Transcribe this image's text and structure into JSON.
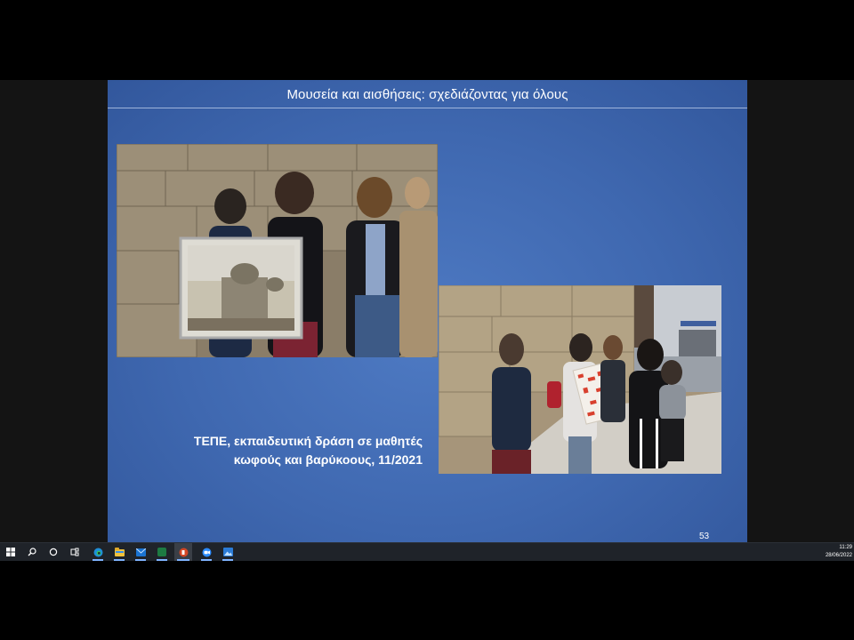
{
  "slide": {
    "title": "Μουσεία και αισθήσεις: σχεδιάζοντας για όλους",
    "caption_line1": "ΤΕΠΕ, εκπαιδευτική δράση σε μαθητές",
    "caption_line2": "κωφούς και βαρύκοους, 11/2021",
    "slide_number": "53",
    "photo_left_icon": "photo-museum-guides-with-painting",
    "photo_right_icon": "photo-students-outdoor-activity"
  },
  "taskbar": {
    "clock_time": "11:29",
    "clock_date": "28/06/2022",
    "icons": [
      "windows-start-icon",
      "search-icon",
      "cortana-icon",
      "task-view-icon",
      "edge-icon",
      "file-explorer-icon",
      "mail-icon",
      "excel-icon",
      "powerpoint-icon",
      "zoom-icon",
      "photos-icon"
    ]
  },
  "colors": {
    "slide_blue": "#4472c4",
    "taskbar": "#1f2329",
    "accent": "#7fb3ff"
  }
}
